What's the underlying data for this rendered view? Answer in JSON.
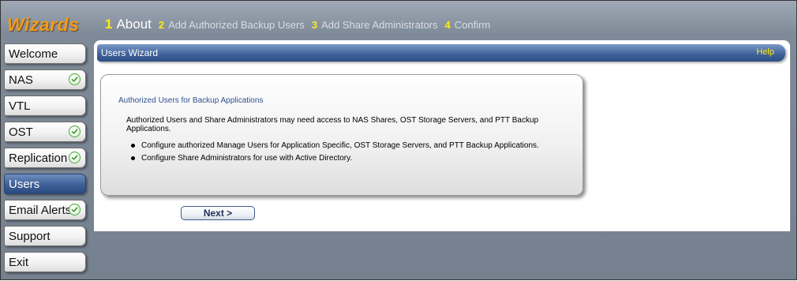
{
  "header": {
    "logo": "Wizards",
    "steps": [
      {
        "num": "1",
        "label": "About"
      },
      {
        "num": "2",
        "label": "Add Authorized Backup Users"
      },
      {
        "num": "3",
        "label": "Add Share Administrators"
      },
      {
        "num": "4",
        "label": "Confirm"
      }
    ],
    "active_step": "1"
  },
  "sidebar": {
    "items": [
      {
        "label": "Welcome",
        "checked": false
      },
      {
        "label": "NAS",
        "checked": true
      },
      {
        "label": "VTL",
        "checked": false
      },
      {
        "label": "OST",
        "checked": true
      },
      {
        "label": "Replication",
        "checked": true
      },
      {
        "label": "Users",
        "checked": false,
        "active": true
      },
      {
        "label": "Email Alerts",
        "checked": true
      },
      {
        "label": "Support",
        "checked": false
      },
      {
        "label": "Exit",
        "checked": false
      }
    ]
  },
  "panel": {
    "title": "Users Wizard",
    "help": "Help",
    "heading": "Authorized Users for Backup Applications",
    "intro": "Authorized Users and Share Administrators may need access to NAS Shares, OST Storage Servers, and PTT Backup Applications.",
    "bullets": [
      "Configure authorized Manage Users for Application Specific, OST Storage Servers, and PTT Backup Applications.",
      "Configure Share Administrators for use with Active Directory."
    ],
    "next_label": "Next >"
  },
  "colors": {
    "logo": "#f39a1c",
    "step_number": "#ffe91a",
    "header_bar": "#3d6098",
    "help_link": "#ffe91a",
    "active_nav": "#3c5f97",
    "check": "#4aa63a"
  },
  "icons": {
    "check": "check-circle-icon"
  }
}
